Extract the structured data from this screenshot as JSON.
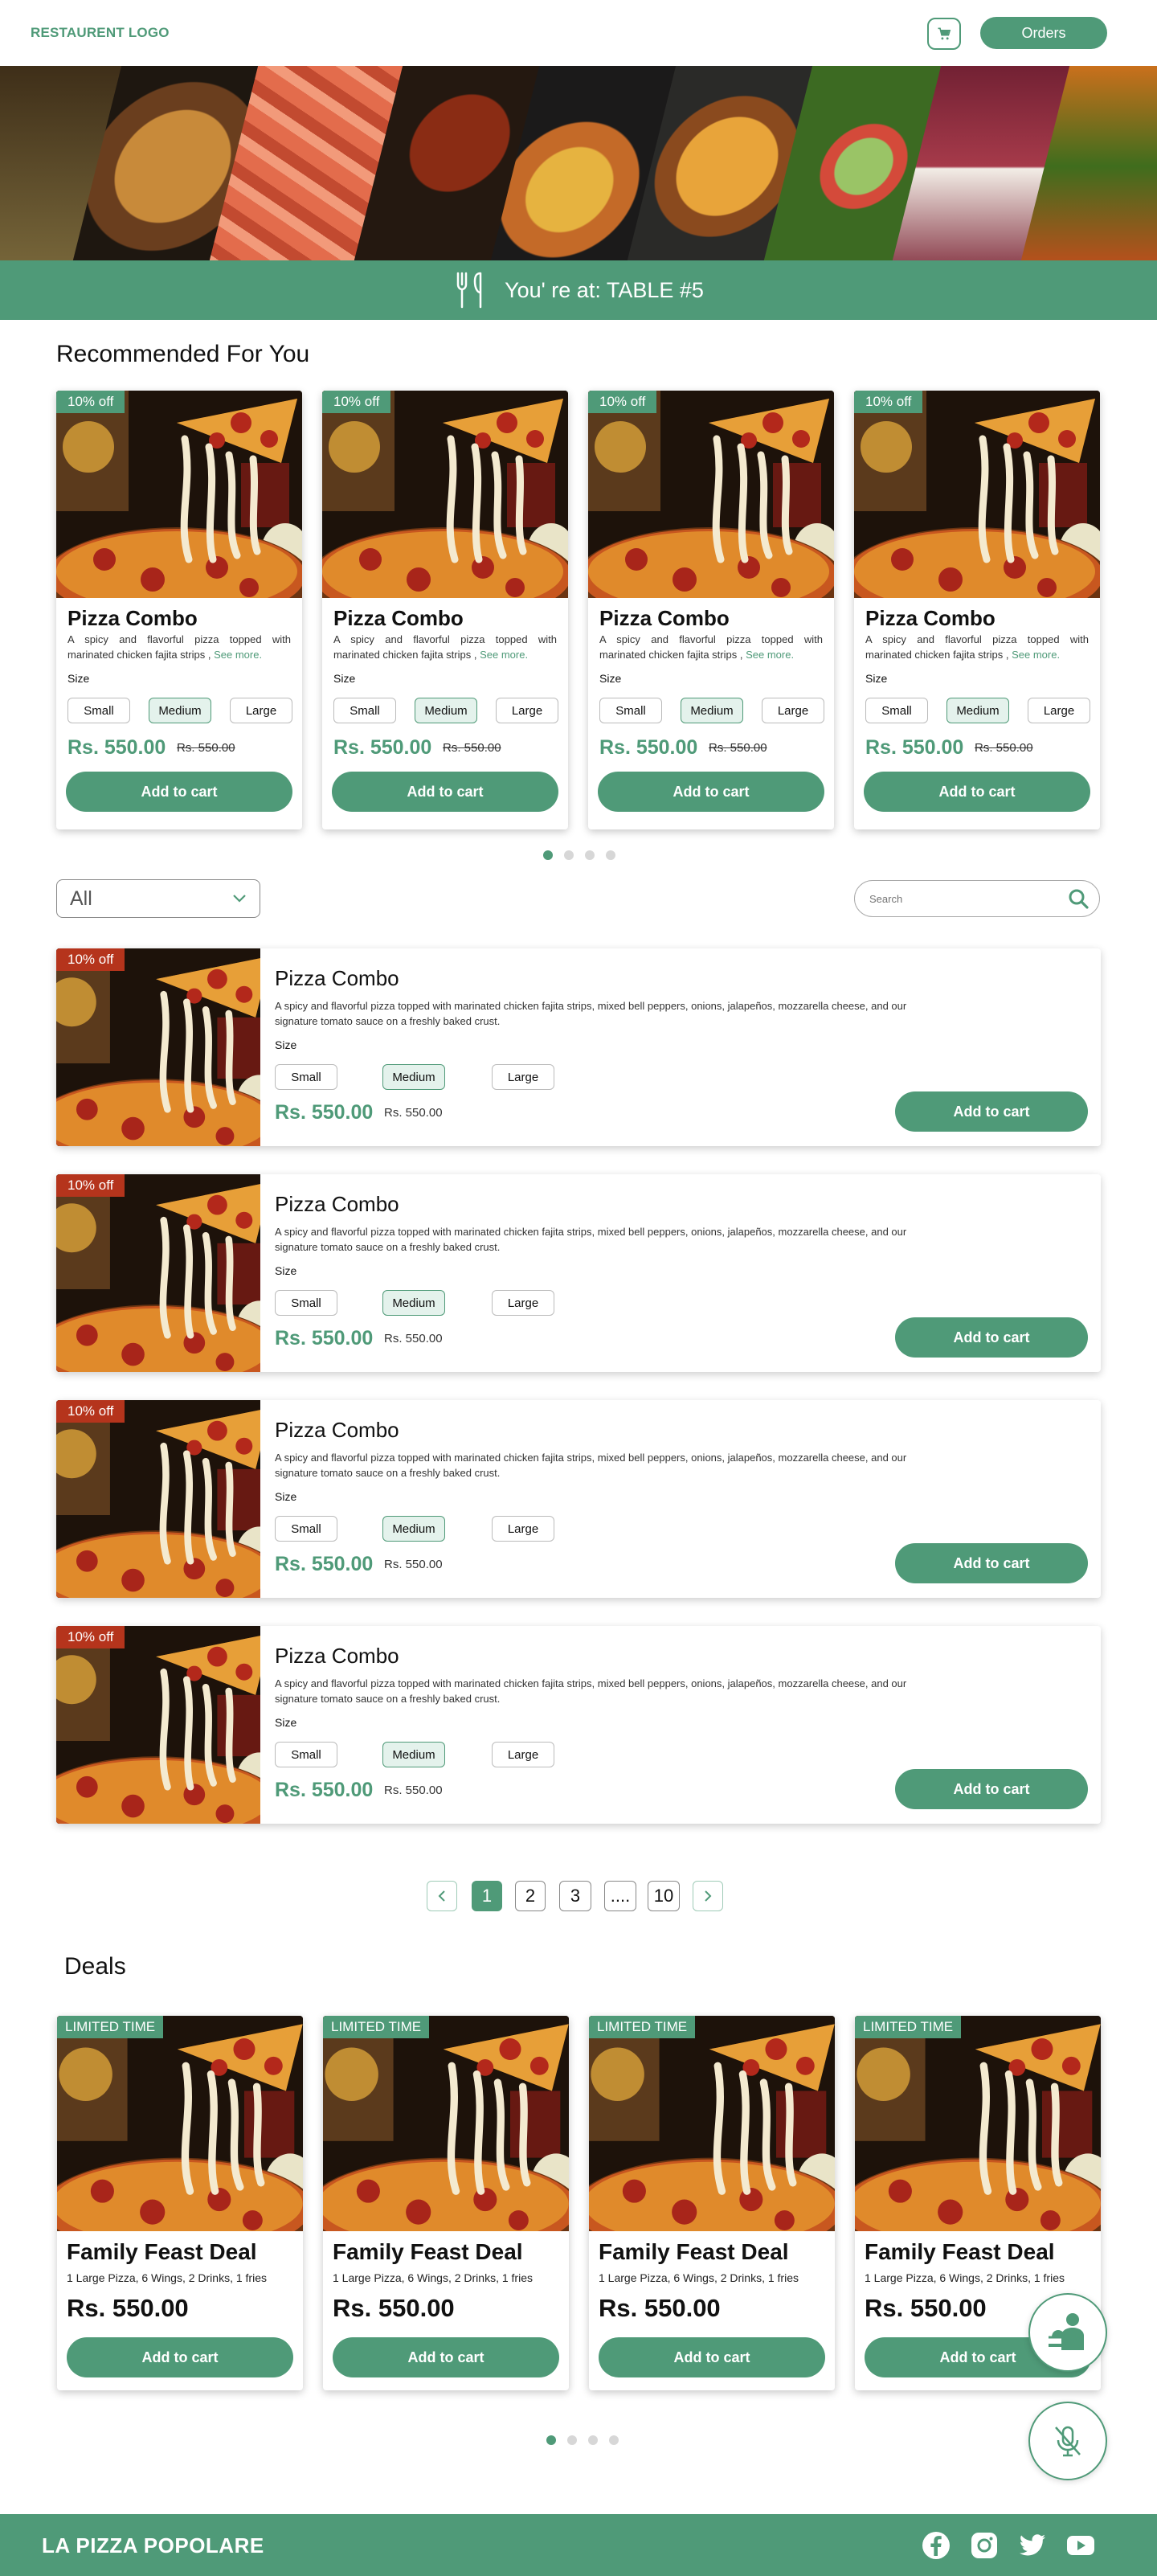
{
  "header": {
    "logo": "RESTAURENT LOGO",
    "orders_label": "Orders"
  },
  "banner": {
    "text": "You' re at: TABLE  #5"
  },
  "recommended": {
    "title": "Recommended For You",
    "cards": [
      {
        "badge": "10% off",
        "title": "Pizza Combo",
        "desc": "A spicy and flavorful pizza topped with marinated chicken fajita strips , ",
        "see_more": "See more.",
        "size_label": "Size",
        "sizes": [
          "Small",
          "Medium",
          "Large"
        ],
        "selected": "Medium",
        "price": "Rs. 550.00",
        "old_price": "Rs. 550.00",
        "cta": "Add to cart"
      },
      {
        "badge": "10% off",
        "title": "Pizza Combo",
        "desc": "A spicy and flavorful pizza topped with marinated chicken fajita strips , ",
        "see_more": "See more.",
        "size_label": "Size",
        "sizes": [
          "Small",
          "Medium",
          "Large"
        ],
        "selected": "Medium",
        "price": "Rs. 550.00",
        "old_price": "Rs. 550.00",
        "cta": "Add to cart"
      },
      {
        "badge": "10% off",
        "title": "Pizza Combo",
        "desc": "A spicy and flavorful pizza topped with marinated chicken fajita strips , ",
        "see_more": "See more.",
        "size_label": "Size",
        "sizes": [
          "Small",
          "Medium",
          "Large"
        ],
        "selected": "Medium",
        "price": "Rs. 550.00",
        "old_price": "Rs. 550.00",
        "cta": "Add to cart"
      },
      {
        "badge": "10% off",
        "title": "Pizza Combo",
        "desc": "A spicy and flavorful pizza topped with marinated chicken fajita strips , ",
        "see_more": "See more.",
        "size_label": "Size",
        "sizes": [
          "Small",
          "Medium",
          "Large"
        ],
        "selected": "Medium",
        "price": "Rs. 550.00",
        "old_price": "Rs. 550.00",
        "cta": "Add to cart"
      }
    ]
  },
  "filter": {
    "selected": "All",
    "search_placeholder": "Search"
  },
  "menu_items": [
    {
      "badge": "10% off",
      "title": "Pizza Combo",
      "desc": "A spicy and flavorful pizza topped with marinated chicken fajita strips, mixed bell peppers, onions, jalapeños, mozzarella cheese, and our signature tomato sauce on a freshly baked crust.",
      "size_label": "Size",
      "sizes": [
        "Small",
        "Medium",
        "Large"
      ],
      "price": "Rs. 550.00",
      "old_price": "Rs. 550.00",
      "cta": "Add to cart"
    },
    {
      "badge": "10% off",
      "title": "Pizza Combo",
      "desc": "A spicy and flavorful pizza topped with marinated chicken fajita strips, mixed bell peppers, onions, jalapeños, mozzarella cheese, and our signature tomato sauce on a freshly baked crust.",
      "size_label": "Size",
      "sizes": [
        "Small",
        "Medium",
        "Large"
      ],
      "price": "Rs. 550.00",
      "old_price": "Rs. 550.00",
      "cta": "Add to cart"
    },
    {
      "badge": "10% off",
      "title": "Pizza Combo",
      "desc": "A spicy and flavorful pizza topped with marinated chicken fajita strips, mixed bell peppers, onions, jalapeños, mozzarella cheese, and our signature tomato sauce on a freshly baked crust.",
      "size_label": "Size",
      "sizes": [
        "Small",
        "Medium",
        "Large"
      ],
      "price": "Rs. 550.00",
      "old_price": "Rs. 550.00",
      "cta": "Add to cart"
    },
    {
      "badge": "10% off",
      "title": "Pizza Combo",
      "desc": "A spicy and flavorful pizza topped with marinated chicken fajita strips, mixed bell peppers, onions, jalapeños, mozzarella cheese, and our signature tomato sauce on a freshly baked crust.",
      "size_label": "Size",
      "sizes": [
        "Small",
        "Medium",
        "Large"
      ],
      "price": "Rs. 550.00",
      "old_price": "Rs. 550.00",
      "cta": "Add to cart"
    }
  ],
  "pagination": {
    "pages": [
      "1",
      "2",
      "3",
      "....",
      "10"
    ],
    "current": "1"
  },
  "deals": {
    "title": "Deals",
    "cards": [
      {
        "badge": "LIMITED TIME",
        "title": "Family Feast Deal",
        "desc": "1 Large Pizza, 6 Wings, 2 Drinks, 1 fries",
        "price": "Rs. 550.00",
        "cta": "Add to cart"
      },
      {
        "badge": "LIMITED TIME",
        "title": "Family Feast Deal",
        "desc": "1 Large Pizza, 6 Wings, 2 Drinks, 1 fries",
        "price": "Rs. 550.00",
        "cta": "Add to cart"
      },
      {
        "badge": "LIMITED TIME",
        "title": "Family Feast Deal",
        "desc": "1 Large Pizza, 6 Wings, 2 Drinks, 1 fries",
        "price": "Rs. 550.00",
        "cta": "Add to cart"
      },
      {
        "badge": "LIMITED TIME",
        "title": "Family Feast Deal",
        "desc": "1 Large Pizza, 6 Wings, 2 Drinks, 1 fries",
        "price": "Rs. 550.00",
        "cta": "Add to cart"
      }
    ]
  },
  "footer": {
    "brand": "LA PIZZA POPOLARE",
    "social_icons": [
      "facebook-icon",
      "instagram-icon",
      "twitter-icon",
      "youtube-icon"
    ]
  },
  "colors": {
    "accent": "#4f9a78",
    "discount_badge": "#b5341c",
    "selected_chip": "#e4f2ec"
  },
  "icons": {
    "cart": "cart-icon",
    "cutlery": "cutlery-icon",
    "chevron": "chevron-down-icon",
    "search": "search-icon",
    "waiter": "waiter-call-icon",
    "mic_off": "mic-off-icon"
  }
}
